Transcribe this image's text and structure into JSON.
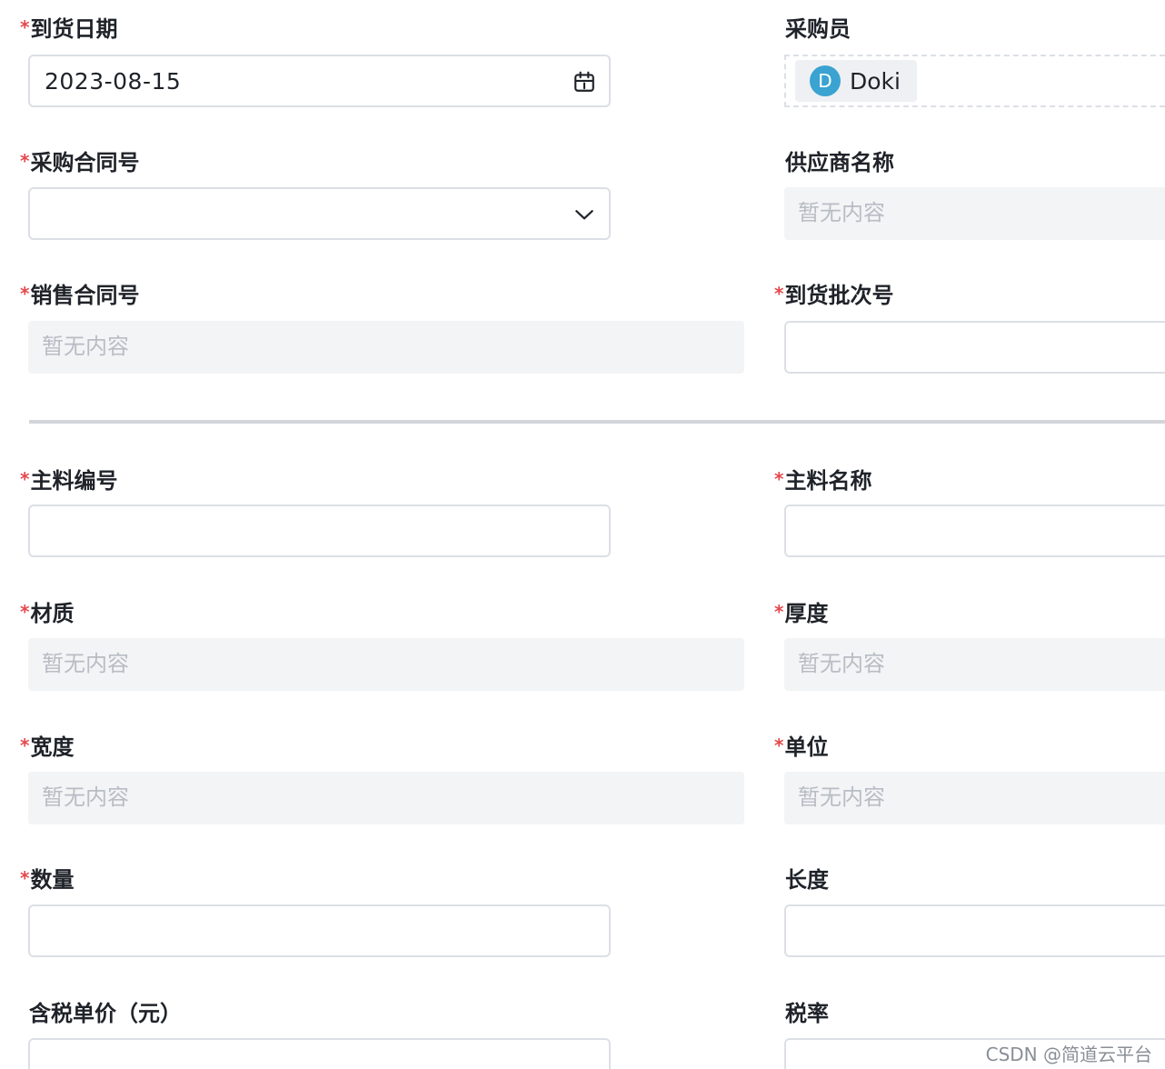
{
  "form": {
    "arrival_date": {
      "label": "到货日期",
      "required": true,
      "value": "2023-08-15"
    },
    "buyer": {
      "label": "采购员",
      "required": false,
      "member": {
        "initial": "D",
        "name": "Doki"
      }
    },
    "purchase_contract_no": {
      "label": "采购合同号",
      "required": true,
      "value": ""
    },
    "supplier_name": {
      "label": "供应商名称",
      "required": false,
      "placeholder": "暂无内容"
    },
    "sales_contract_no": {
      "label": "销售合同号",
      "required": true,
      "placeholder": "暂无内容"
    },
    "arrival_batch_no": {
      "label": "到货批次号",
      "required": true,
      "value": ""
    },
    "main_material_code": {
      "label": "主料编号",
      "required": true,
      "value": ""
    },
    "main_material_name": {
      "label": "主料名称",
      "required": true,
      "value": ""
    },
    "material": {
      "label": "材质",
      "required": true,
      "placeholder": "暂无内容"
    },
    "thickness": {
      "label": "厚度",
      "required": true,
      "placeholder": "暂无内容"
    },
    "width": {
      "label": "宽度",
      "required": true,
      "placeholder": "暂无内容"
    },
    "unit": {
      "label": "单位",
      "required": true,
      "placeholder": "暂无内容"
    },
    "quantity": {
      "label": "数量",
      "required": true,
      "value": ""
    },
    "length": {
      "label": "长度",
      "required": false,
      "value": ""
    },
    "unit_price_incl_tax": {
      "label": "含税单价（元）",
      "required": false,
      "value": ""
    },
    "tax_rate": {
      "label": "税率",
      "required": false,
      "value": ""
    }
  },
  "required_mark": "*",
  "icons": {
    "date_picker": "calendar-icon",
    "dropdown": "chevron-down-icon"
  },
  "colors": {
    "required": "#e5484d",
    "avatar": "#3aa3d1",
    "readonly_bg": "#f3f4f6",
    "border": "#dcdfe5",
    "placeholder": "#b8bcc4"
  },
  "watermark": "CSDN @简道云平台"
}
